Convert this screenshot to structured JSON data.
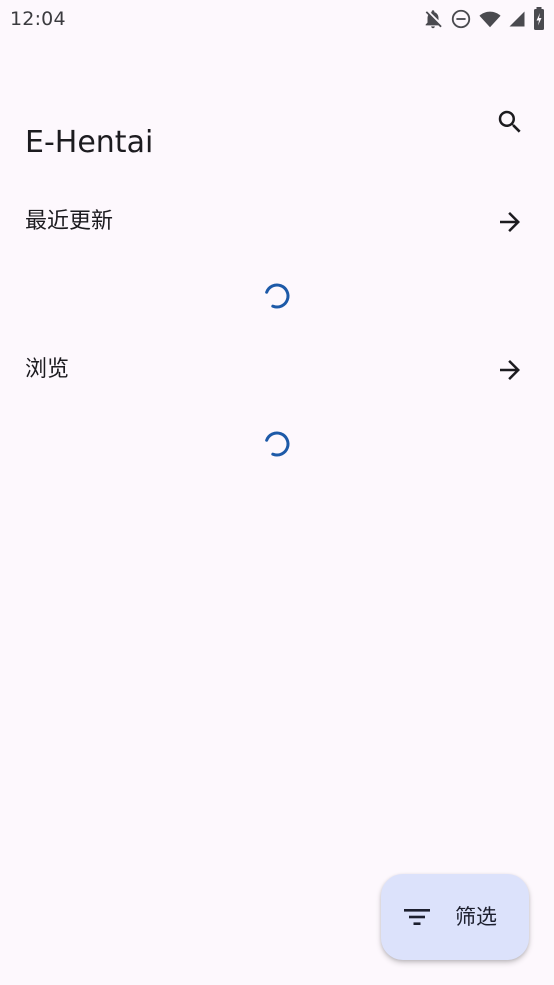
{
  "status_bar": {
    "time": "12:04",
    "icons": [
      "notifications-off-icon",
      "do-not-disturb-icon",
      "wifi-icon",
      "cell-signal-icon",
      "battery-charging-icon"
    ]
  },
  "app_bar": {
    "title": "E-Hentai",
    "search_icon": "search-icon"
  },
  "sections": [
    {
      "title": "最近更新",
      "arrow_icon": "arrow-forward-icon",
      "loading": true
    },
    {
      "title": "浏览",
      "arrow_icon": "arrow-forward-icon",
      "loading": true
    }
  ],
  "fab": {
    "label": "筛选",
    "icon": "filter-list-icon"
  },
  "colors": {
    "background": "#fdf8fd",
    "text": "#1c1b1f",
    "spinner": "#1d5aa8",
    "fab_background": "#dce2fb"
  }
}
